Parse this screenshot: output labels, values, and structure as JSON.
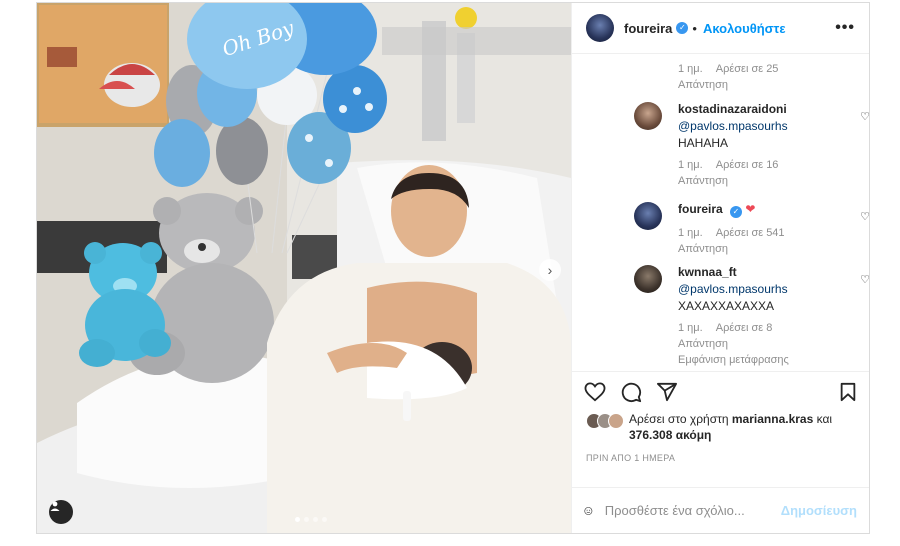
{
  "header": {
    "username": "foureira",
    "separator": "•",
    "follow_label": "Ακολουθήστε",
    "more_label": "•••"
  },
  "comments_top": {
    "time": "1 ημ.",
    "likes": "Αρέσει σε 25",
    "reply": "Απάντηση"
  },
  "comments": [
    {
      "username": "kostadinazaraidoni",
      "mention": "@pavlos.mpasourhs",
      "text": "HAHAHA",
      "time": "1 ημ.",
      "likes": "Αρέσει σε 16",
      "reply": "Απάντηση"
    },
    {
      "username": "foureira",
      "heart": "❤",
      "time": "1 ημ.",
      "likes": "Αρέσει σε 541",
      "reply": "Απάντηση"
    },
    {
      "username": "kwnnaa_ft",
      "mention": "@pavlos.mpasourhs",
      "text": "ΧΑΧΑΧΧΑΧΑΧΧΑ",
      "time": "1 ημ.",
      "likes": "Αρέσει σε 8",
      "reply": "Απάντηση",
      "translate": "Εμφάνιση μετάφρασης"
    }
  ],
  "likes": {
    "prefix": "Αρέσει στο χρήστη",
    "user": "marianna.kras",
    "and": "και",
    "count": "376.308 ακόμη"
  },
  "time_ago": "ΠΡΙΝ ΑΠΟ 1 ΗΜΕΡΑ",
  "add_comment": {
    "placeholder": "Προσθέστε ένα σχόλιο...",
    "publish_label": "Δημοσίευση"
  },
  "photo": {
    "balloon_text": "Oh Boy",
    "carousel_index": 1,
    "carousel_count": 4
  },
  "colors": {
    "accent": "#0095f6",
    "heart": "#ed4956",
    "balloon_blue": "#6ab0e0",
    "teddy_blue": "#4ebde0"
  }
}
